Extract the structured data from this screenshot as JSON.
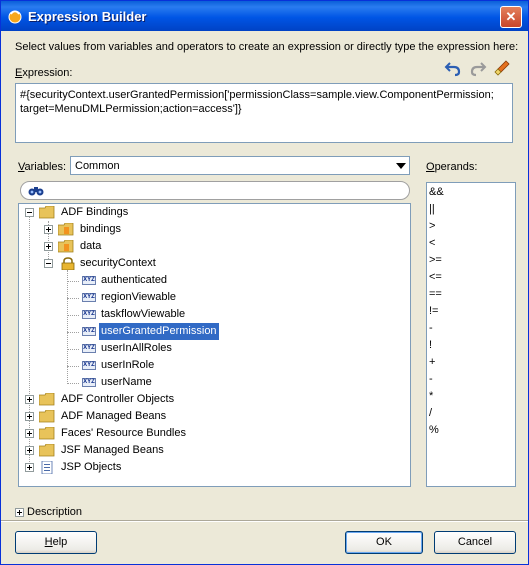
{
  "window": {
    "title": "Expression Builder",
    "close_label": "✕"
  },
  "instructions": "Select values from variables and operators to create an expression or directly type the expression here:",
  "expression": {
    "label": "Expression:",
    "value": "#{securityContext.userGrantedPermission['permissionClass=sample.view.ComponentPermission; target=MenuDMLPermission;action=access']}"
  },
  "toolbar": {
    "icons": [
      "undo-icon",
      "redo-icon",
      "clear-icon"
    ]
  },
  "variables": {
    "label": "Variables:",
    "selected": "Common"
  },
  "search": {
    "placeholder": "",
    "icon": "binoculars-icon"
  },
  "tree": {
    "root": "ADF Bindings",
    "bindings": "bindings",
    "data": "data",
    "securityContext": "securityContext",
    "children": [
      "authenticated",
      "regionViewable",
      "taskflowViewable",
      "userGrantedPermission",
      "userInAllRoles",
      "userInRole",
      "userName"
    ],
    "others": [
      "ADF Controller Objects",
      "ADF Managed Beans",
      "Faces' Resource Bundles",
      "JSF Managed Beans",
      "JSP Objects"
    ],
    "leaf_badge": "XYZ"
  },
  "operands": {
    "label": "Operands:",
    "items": [
      "&&",
      "||",
      ">",
      "<",
      ">=",
      "<=",
      "==",
      "!=",
      "-",
      "!",
      "+",
      "-",
      "*",
      "/",
      "%"
    ]
  },
  "description": {
    "label": "Description"
  },
  "buttons": {
    "help": "Help",
    "ok": "OK",
    "cancel": "Cancel"
  },
  "colors": {
    "titlebar": "#0055e5",
    "selection": "#316ac5",
    "folder": "#e8c35a"
  }
}
